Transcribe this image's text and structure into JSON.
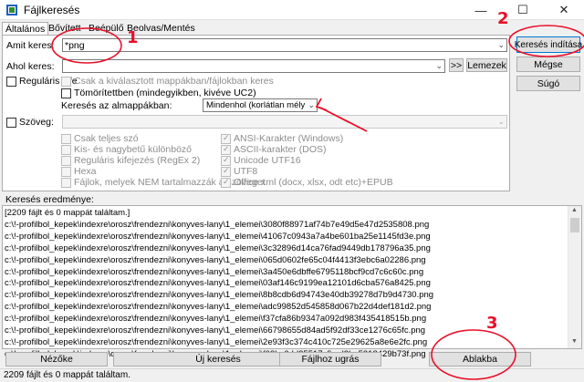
{
  "window": {
    "title": "Fájlkeresés",
    "minimize": "—",
    "maximize": "☐",
    "close": "✕"
  },
  "tabs": [
    "Általános",
    "Bővített",
    "Beépülő",
    "Beolvas/Mentés"
  ],
  "search": {
    "name_label": "Amit keres:",
    "name_value": "*png",
    "where_label": "Ahol keres:",
    "where_value": "",
    "browse_button": ">>",
    "drives_button": "Lemezek",
    "regex_label": "Reguláris kife",
    "only_selected_label": "Csak a kiválasztott mappákban/fájlokban keres",
    "archives_label": "Tömörítettben (mindegyikben, kivéve UC2)",
    "subdir_label": "Keresés az almappákban:",
    "subdir_value": "Mindenhol (korlátlan mélységbe"
  },
  "text_search": {
    "label": "Szöveg:",
    "options_left": [
      "Csak teljes szó",
      "Kis- és nagybetű különböző",
      "Reguláris kifejezés (RegEx 2)",
      "Hexa",
      "Fájlok, melyek NEM tartalmazzák a szöveget"
    ],
    "options_right": [
      "ANSI-Karakter (Windows)",
      "ASCII-karakter (DOS)",
      "Unicode UTF16",
      "UTF8",
      "Office xml (docx, xlsx, odt etc)+EPUB"
    ]
  },
  "side_buttons": {
    "start": "Keresés indítása",
    "cancel": "Mégse",
    "help": "Súgó"
  },
  "results": {
    "label": "Keresés eredménye:",
    "rows": [
      "[2209 fájlt és 0 mappát találtam.]",
      "c:\\!-profilbol_kepek\\indexre\\orosz\\frendezni\\konyves-lany\\1_elemei\\3080f88971af74b7e49d5e47d2535808.png",
      "c:\\!-profilbol_kepek\\indexre\\orosz\\frendezni\\konyves-lany\\1_elemei\\41067c0943a7a4be601ba25e1145fd3e.png",
      "c:\\!-profilbol_kepek\\indexre\\orosz\\frendezni\\konyves-lany\\1_elemei\\3c32896d14ca76fad9449db178796a35.png",
      "c:\\!-profilbol_kepek\\indexre\\orosz\\frendezni\\konyves-lany\\1_elemei\\065d0602fe65c04f4413f3ebc6a02286.png",
      "c:\\!-profilbol_kepek\\indexre\\orosz\\frendezni\\konyves-lany\\1_elemei\\3a450e6dbffe6795118bcf9cd7c6c60c.png",
      "c:\\!-profilbol_kepek\\indexre\\orosz\\frendezni\\konyves-lany\\1_elemei\\03af146c9199ea12101d6cba576a8425.png",
      "c:\\!-profilbol_kepek\\indexre\\orosz\\frendezni\\konyves-lany\\1_elemei\\8b8cdb6d94743e40db39278d7b9d4730.png",
      "c:\\!-profilbol_kepek\\indexre\\orosz\\frendezni\\konyves-lany\\1_elemei\\adc99852d545858d067b22d4def181d2.png",
      "c:\\!-profilbol_kepek\\indexre\\orosz\\frendezni\\konyves-lany\\1_elemei\\f37cfa86b9347a092d983f435418515b.png",
      "c:\\!-profilbol_kepek\\indexre\\orosz\\frendezni\\konyves-lany\\1_elemei\\66798655d84ad5f92df33ce1276c65fc.png",
      "c:\\!-profilbol_kepek\\indexre\\orosz\\frendezni\\konyves-lany\\1_elemei\\2e93f3c374c410c725e29625a8e6e2fc.png",
      "c:\\!-profilbol_kepek\\indexre\\orosz\\frendezni\\konyves-lany\\1_elemei\\f03bc6dd35517cfbed2be5318429b73f.png"
    ]
  },
  "bottom_buttons": [
    "Nézőke",
    "Új keresés",
    "Fájlhoz ugrás",
    "Ablakba"
  ],
  "status": "2209 fájlt és 0 mappát találtam.",
  "annotations": {
    "n1": "1",
    "n2": "2",
    "n3": "3",
    "color": "#e8102a"
  }
}
